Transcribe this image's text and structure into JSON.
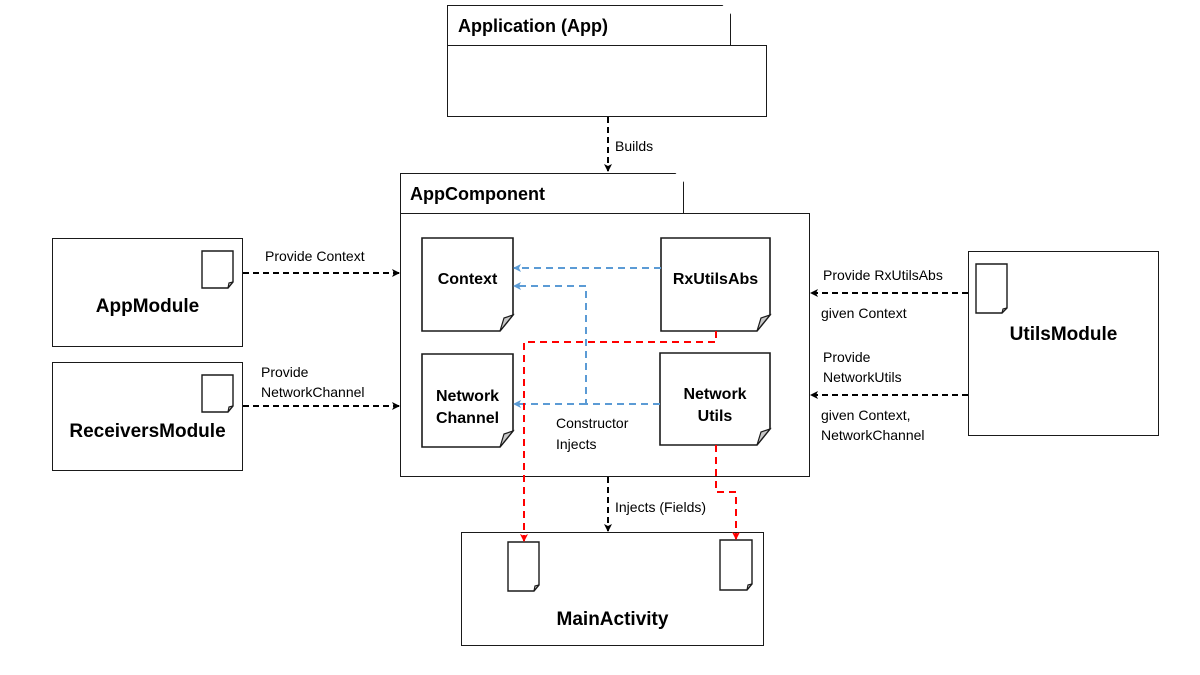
{
  "diagram": {
    "packages": {
      "application": {
        "title": "Application (App)"
      },
      "app_component": {
        "title": "AppComponent"
      }
    },
    "modules": {
      "app_module": {
        "label": "AppModule"
      },
      "receivers_module": {
        "label": "ReceiversModule"
      },
      "utils_module": {
        "label": "UtilsModule"
      },
      "main_activity": {
        "label": "MainActivity"
      }
    },
    "component_nodes": {
      "context": {
        "label": "Context"
      },
      "rx_utils_abs": {
        "label": "RxUtilsAbs"
      },
      "network_channel": {
        "label_line1": "Network",
        "label_line2": "Channel"
      },
      "network_utils": {
        "label_line1": "Network",
        "label_line2": "Utils"
      }
    },
    "edges": {
      "builds": {
        "label": "Builds",
        "from": "Application (App)",
        "to": "AppComponent",
        "style": "dashed",
        "color": "#000000"
      },
      "provide_context": {
        "label": "Provide Context",
        "from": "AppModule",
        "to": "AppComponent",
        "style": "dashed",
        "color": "#000000"
      },
      "provide_network_channel": {
        "label_line1": "Provide",
        "label_line2": "NetworkChannel",
        "from": "ReceiversModule",
        "to": "AppComponent",
        "style": "dashed",
        "color": "#000000"
      },
      "provide_rx_utils_abs": {
        "label_above": "Provide RxUtilsAbs",
        "label_below": "given Context",
        "from": "UtilsModule",
        "to": "AppComponent",
        "style": "dashed",
        "color": "#000000"
      },
      "provide_network_utils": {
        "label_above_line1": "Provide",
        "label_above_line2": "NetworkUtils",
        "label_below_line1": "given Context,",
        "label_below_line2": "NetworkChannel",
        "from": "UtilsModule",
        "to": "AppComponent",
        "style": "dashed",
        "color": "#000000"
      },
      "constructor_injects": {
        "label_line1": "Constructor",
        "label_line2": "Injects",
        "style": "dashed",
        "color": "#5b9bd5"
      },
      "injects_fields": {
        "label": "Injects (Fields)",
        "from": "AppComponent",
        "to": "MainActivity",
        "style": "dashed",
        "color": "#000000"
      },
      "field_injection": {
        "style": "dashed",
        "color": "#ff0000"
      }
    }
  }
}
